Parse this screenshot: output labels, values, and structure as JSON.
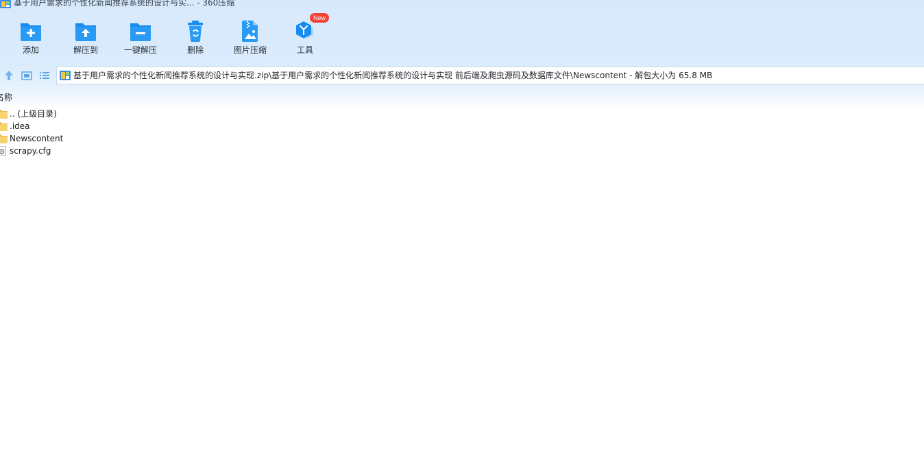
{
  "window": {
    "title": "基于用户需求的个性化新闻推荐系统的设计与实... - 360压缩"
  },
  "toolbar": {
    "items": [
      {
        "label": "添加",
        "icon": "add-folder-icon"
      },
      {
        "label": "解压到",
        "icon": "extract-to-icon"
      },
      {
        "label": "一键解压",
        "icon": "one-click-extract-icon"
      },
      {
        "label": "删除",
        "icon": "recycle-bin-icon"
      },
      {
        "label": "图片压缩",
        "icon": "image-compress-icon"
      },
      {
        "label": "工具",
        "icon": "tools-cube-icon",
        "badge": "New"
      }
    ]
  },
  "nav": {
    "up_icon": "arrow-up-icon",
    "thumbnail_icon": "thumbnail-view-icon",
    "list_icon": "list-view-icon"
  },
  "address": {
    "path": "基于用户需求的个性化新闻推荐系统的设计与实现.zip\\基于用户需求的个性化新闻推荐系统的设计与实现 前后端及爬虫源码及数据库文件\\Newscontent - 解包大小为 65.8 MB"
  },
  "columns": {
    "name": "名称"
  },
  "files": [
    {
      "name": ".. (上级目录)",
      "type": "folder"
    },
    {
      "name": ".idea",
      "type": "folder"
    },
    {
      "name": "Newscontent",
      "type": "folder"
    },
    {
      "name": "scrapy.cfg",
      "type": "config-file"
    }
  ],
  "colors": {
    "accent_blue": "#1a8cf0",
    "badge_red": "#f24336",
    "toolbar_bg": "#d7e9fb",
    "folder_yellow": "#f7d36b"
  }
}
